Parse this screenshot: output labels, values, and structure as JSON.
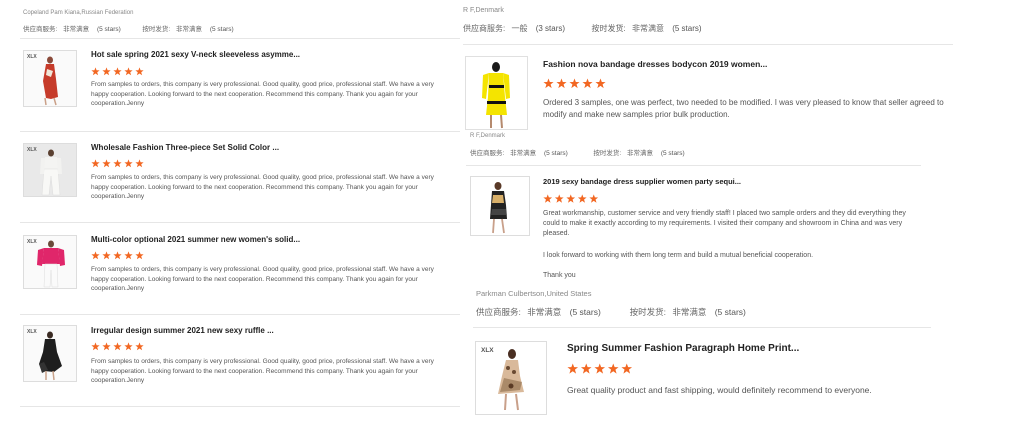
{
  "labels": {
    "supplier_service": "供应商服务:",
    "on_time_delivery": "按时发货:"
  },
  "left_header": {
    "reviewer": "Copeland Pam Kiana,Russian Federation",
    "supplier_value": "非常满意",
    "supplier_stars": "(5 stars)",
    "delivery_value": "非常满意",
    "delivery_stars": "(5 stars)"
  },
  "left_reviews": [
    {
      "title": "Hot sale spring 2021 sexy V-neck sleeveless asymme...",
      "rating": 5,
      "text": "From samples to orders, this company is very professional. Good quality, good price, professional staff. We have a very happy cooperation. Looking forward to the next cooperation. Recommend this company. Thank you again for your cooperation.Jenny"
    },
    {
      "title": "Wholesale Fashion Three-piece Set Solid Color ...",
      "rating": 5,
      "text": "From samples to orders, this company is very professional. Good quality, good price, professional staff. We have a very happy cooperation. Looking forward to the next cooperation. Recommend this company. Thank you again for your cooperation.Jenny"
    },
    {
      "title": "Multi-color optional 2021 summer new women's solid...",
      "rating": 5,
      "text": "From samples to orders, this company is very professional. Good quality, good price, professional staff. We have a very happy cooperation. Looking forward to the next cooperation. Recommend this company. Thank you again for your cooperation.Jenny"
    },
    {
      "title": "Irregular design summer 2021 new sexy ruffle ...",
      "rating": 5,
      "text": "From samples to orders, this company is very professional. Good quality, good price, professional staff. We have a very happy cooperation. Looking forward to the next cooperation. Recommend this company. Thank you again for your cooperation.Jenny"
    }
  ],
  "right_header": {
    "reviewer": "R F,Denmark",
    "supplier_value": "一般",
    "supplier_stars": "(3 stars)",
    "delivery_value": "非常满意",
    "delivery_stars": "(5 stars)"
  },
  "right_reviews": [
    {
      "title": "Fashion nova bandage dresses bodycon 2019 women...",
      "rating": 5,
      "text": "Ordered 3 samples, one was perfect, two needed to be modified. I was very pleased to know that seller agreed to modify and make new samples prior bulk production."
    },
    {
      "title": "2019 sexy bandage dress supplier women party sequi...",
      "rating": 5,
      "text": "Great workmanship, customer service and very friendly staff! I placed two sample orders and they did everything they could to make it exactly according to my requirements. I visited their company and showroom in China and was very pleased.",
      "text2": "I look forward to working with them long term and build a mutual beneficial cooperation.",
      "text3": "Thank you"
    },
    {
      "title": "Spring Summer Fashion Paragraph Home Print...",
      "rating": 5,
      "text": "Great quality product and fast shipping, would definitely recommend to everyone."
    }
  ],
  "right_meta_2": {
    "reviewer": "R F,Denmark",
    "supplier_value": "非常满意",
    "supplier_stars": "(5 stars)",
    "delivery_value": "非常满意",
    "delivery_stars": "(5 stars)"
  },
  "right_meta_3": {
    "reviewer": "Parkman Culbertson,United States",
    "supplier_value": "非常满意",
    "supplier_stars": "(5 stars)",
    "delivery_value": "非常满意",
    "delivery_stars": "(5 stars)"
  },
  "brand_mark": "XLX",
  "colors": {
    "star": "#f26722",
    "divider": "#e6e6e6"
  }
}
